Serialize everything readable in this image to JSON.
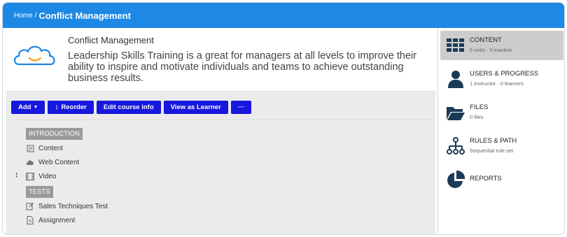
{
  "breadcrumb": {
    "home": "Home",
    "separator": "/",
    "current": "Conflict Management"
  },
  "course": {
    "title": "Conflict Management",
    "description": "Leadership Skills Training is a great for managers at all levels to improve their ability to inspire and motivate individuals and teams to achieve outstanding business results."
  },
  "toolbar": {
    "add_label": "Add",
    "reorder_label": "Reorder",
    "edit_label": "Edit course info",
    "view_label": "View as Learner",
    "more_label": "···"
  },
  "sections": {
    "introduction": "INTRODUCTION",
    "tests": "TESTS"
  },
  "units": {
    "content": "Content",
    "web_content": "Web Content",
    "video": "Video",
    "sales_test": "Sales Techniques Test",
    "assignment": "Assignment"
  },
  "sidebar": {
    "content": {
      "title": "CONTENT",
      "sub": "5 units · 0 inactive"
    },
    "users": {
      "title": "USERS & PROGRESS",
      "sub": "1 instructor · 0 learners"
    },
    "files": {
      "title": "FILES",
      "sub": "0 files"
    },
    "rules": {
      "title": "RULES & PATH",
      "sub": "Sequential rule set"
    },
    "reports": {
      "title": "REPORTS"
    }
  },
  "colors": {
    "header": "#1e88e5",
    "button": "#1717dd",
    "sidebar_icon": "#1b3a57",
    "logo_cloud": "#1e88e5",
    "logo_smile": "#f5a623"
  }
}
